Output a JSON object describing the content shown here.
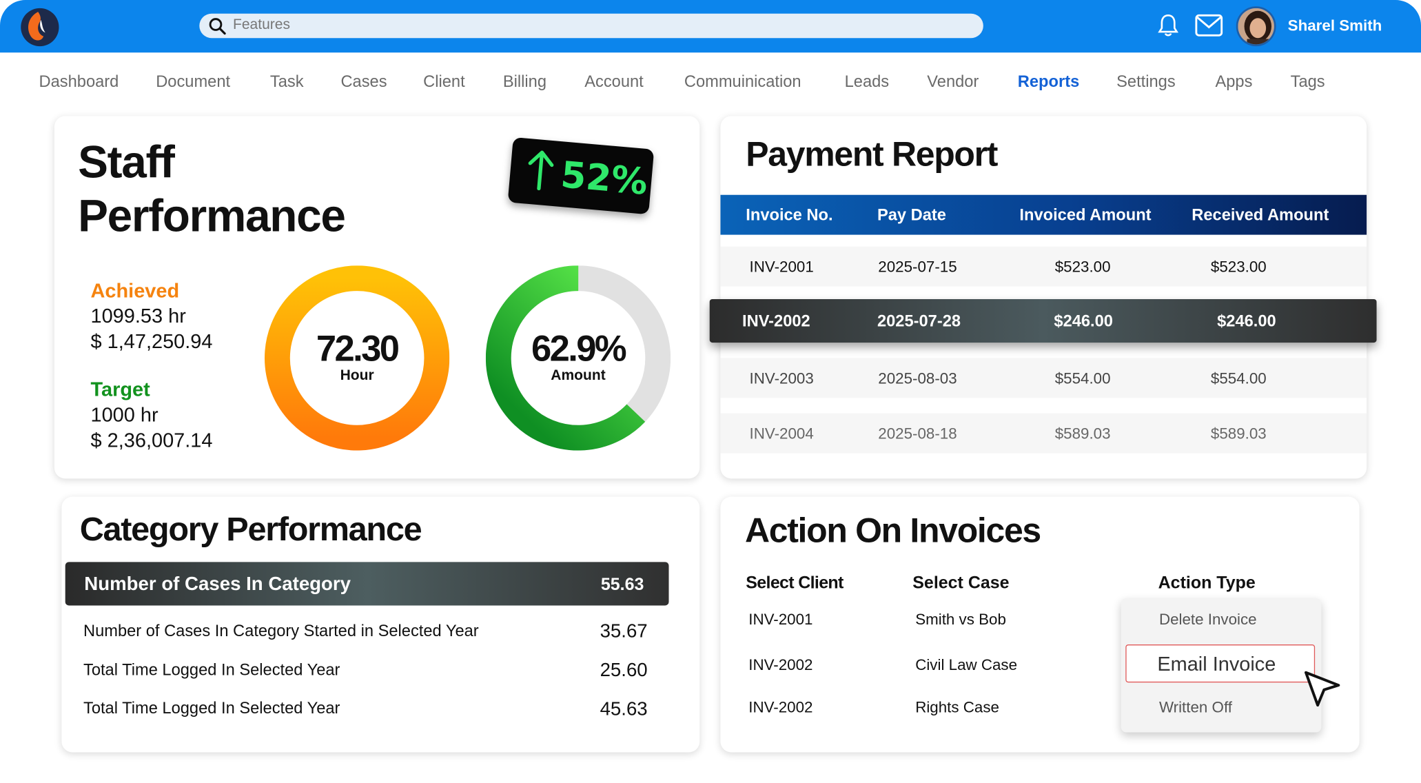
{
  "header": {
    "search_placeholder": "Features",
    "user_name": "Sharel Smith"
  },
  "nav": [
    "Dashboard",
    "Document",
    "Task",
    "Cases",
    "Client",
    "Billing",
    "Account",
    "Commuinication",
    "Leads",
    "Vendor",
    "Reports",
    "Settings",
    "Apps",
    "Tags"
  ],
  "nav_active": "Reports",
  "staff": {
    "title_line1": "Staff",
    "title_line2": "Performance",
    "badge": "52%",
    "achieved_label": "Achieved",
    "achieved_hours": "1099.53 hr",
    "achieved_amount": "$ 1,47,250.94",
    "target_label": "Target",
    "target_hours": "1000 hr",
    "target_amount": "$ 2,36,007.14",
    "ring1_value": "72.30",
    "ring1_label": "Hour",
    "ring2_value": "62.9%",
    "ring2_label": "Amount",
    "ring2_fraction": 0.629
  },
  "payment": {
    "title": "Payment Report",
    "headers": [
      "Invoice No.",
      "Pay Date",
      "Invoiced Amount",
      "Received Amount"
    ],
    "rows": [
      [
        "INV-2001",
        "2025-07-15",
        "$523.00",
        "$523.00"
      ],
      [
        "INV-2002",
        "2025-07-28",
        "$246.00",
        "$246.00"
      ],
      [
        "INV-2003",
        "2025-08-03",
        "$554.00",
        "$554.00"
      ],
      [
        "INV-2004",
        "2025-08-18",
        "$589.03",
        "$589.03"
      ]
    ]
  },
  "category": {
    "title": "Category Performance",
    "header_label": "Number of Cases In Category",
    "header_value": "55.63",
    "rows": [
      {
        "label": "Number of Cases In Category Started in Selected Year",
        "value": "35.67"
      },
      {
        "label": "Total Time Logged In Selected Year",
        "value": "25.60"
      },
      {
        "label": "Total Time Logged In Selected Year",
        "value": "45.63"
      }
    ]
  },
  "actions": {
    "title": "Action On Invoices",
    "col_client": "Select Client",
    "col_case": "Select Case",
    "col_action": "Action Type",
    "rows": [
      {
        "client": "INV-2001",
        "case": "Smith vs Bob"
      },
      {
        "client": "INV-2002",
        "case": "Civil Law Case"
      },
      {
        "client": "INV-2002",
        "case": "Rights Case"
      }
    ],
    "options": [
      "Delete Invoice",
      "Email Invoice",
      "Written Off"
    ],
    "selected": "Email Invoice"
  },
  "colors": {
    "brand_blue": "#0c85ec",
    "active_nav": "#1462d6",
    "achieved": "#f5830f",
    "target": "#12921e",
    "badge_text": "#2fe86a"
  },
  "icons": [
    "search-icon",
    "bell-icon",
    "mail-icon",
    "cursor-icon",
    "arrow-up-icon"
  ]
}
